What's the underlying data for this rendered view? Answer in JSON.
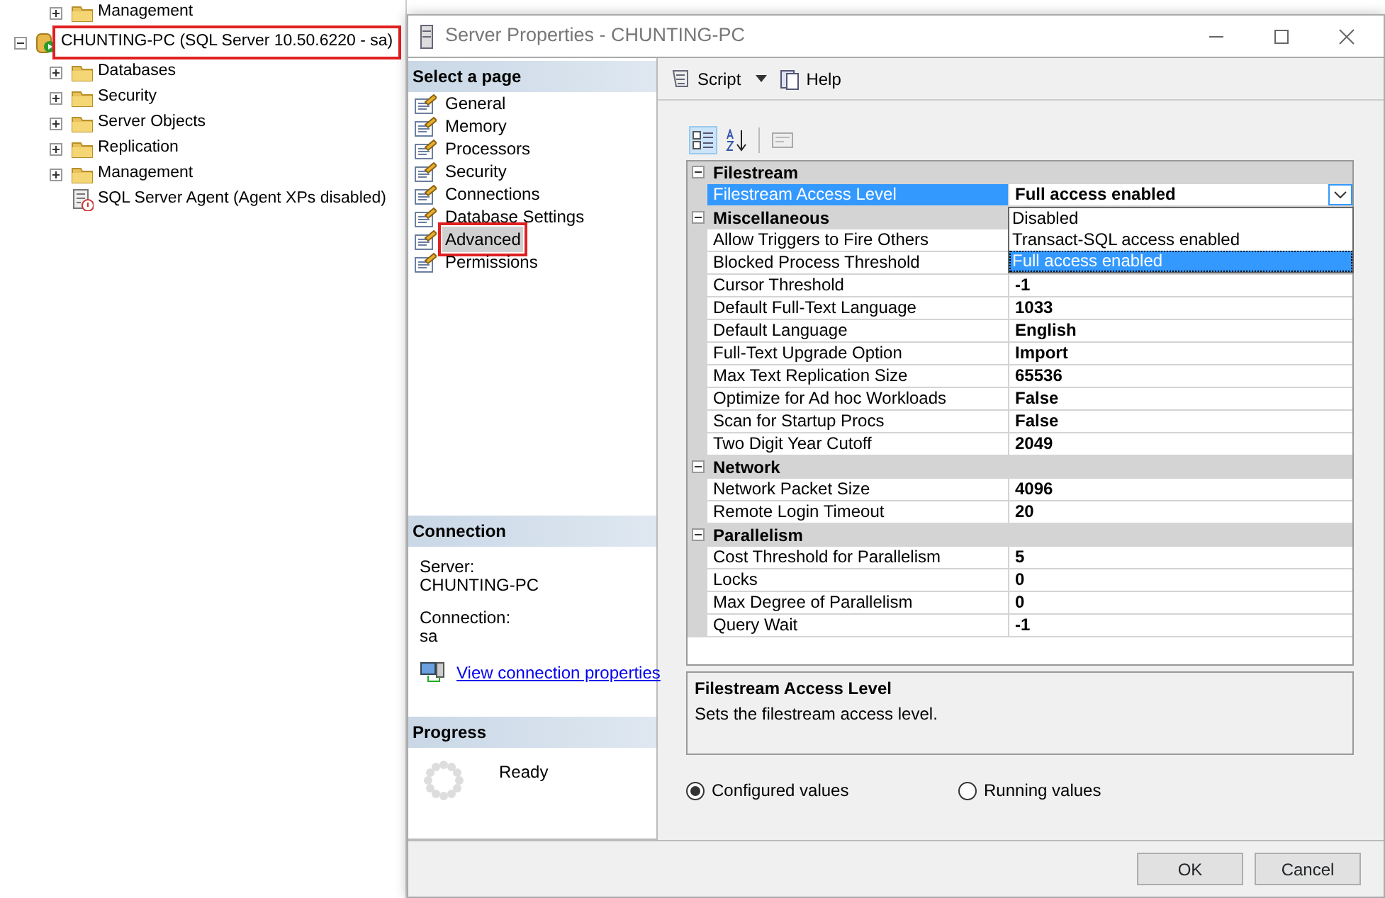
{
  "tree": {
    "above": [
      {
        "label": "Management",
        "expanded": false
      }
    ],
    "root": {
      "label": "CHUNTING-PC (SQL Server 10.50.6220 - sa)",
      "expanded": true,
      "highlighted": true,
      "children": [
        {
          "kind": "folder",
          "label": "Databases",
          "expanded": false
        },
        {
          "kind": "folder",
          "label": "Security",
          "expanded": false
        },
        {
          "kind": "folder",
          "label": "Server Objects",
          "expanded": false
        },
        {
          "kind": "folder",
          "label": "Replication",
          "expanded": false
        },
        {
          "kind": "folder",
          "label": "Management",
          "expanded": false
        },
        {
          "kind": "agent",
          "label": "SQL Server Agent (Agent XPs disabled)"
        }
      ]
    }
  },
  "dialog": {
    "title": "Server Properties - CHUNTING-PC",
    "select_header": "Select a page",
    "pages": [
      {
        "label": "General",
        "selected": false,
        "highlighted": false
      },
      {
        "label": "Memory",
        "selected": false,
        "highlighted": false
      },
      {
        "label": "Processors",
        "selected": false,
        "highlighted": false
      },
      {
        "label": "Security",
        "selected": false,
        "highlighted": false
      },
      {
        "label": "Connections",
        "selected": false,
        "highlighted": false
      },
      {
        "label": "Database Settings",
        "selected": false,
        "highlighted": false
      },
      {
        "label": "Advanced",
        "selected": true,
        "highlighted": true
      },
      {
        "label": "Permissions",
        "selected": false,
        "highlighted": false
      }
    ],
    "connection": {
      "header": "Connection",
      "server_label": "Server:",
      "server": "CHUNTING-PC",
      "connection_label": "Connection:",
      "connection": "sa",
      "link": "View connection properties"
    },
    "progress": {
      "header": "Progress",
      "status": "Ready"
    },
    "toolbar": {
      "script": "Script",
      "help": "Help"
    },
    "grid": {
      "categories": [
        {
          "name": "Filestream",
          "expanded": true,
          "properties": [
            {
              "name": "Filestream Access Level",
              "value": "Full access enabled",
              "selected": true,
              "dropdown": {
                "open": true,
                "options": [
                  {
                    "label": "Disabled",
                    "selected": false
                  },
                  {
                    "label": "Transact-SQL access enabled",
                    "selected": false
                  },
                  {
                    "label": "Full access enabled",
                    "selected": true
                  }
                ]
              }
            }
          ]
        },
        {
          "name": "Miscellaneous",
          "expanded": true,
          "properties": [
            {
              "name": "Allow Triggers to Fire Others",
              "selected": false
            },
            {
              "name": "Blocked Process Threshold",
              "selected": false
            },
            {
              "name": "Cursor Threshold",
              "value": "-1",
              "selected": false
            },
            {
              "name": "Default Full-Text Language",
              "value": "1033",
              "selected": false
            },
            {
              "name": "Default Language",
              "value": "English",
              "selected": false
            },
            {
              "name": "Full-Text Upgrade Option",
              "value": "Import",
              "selected": false
            },
            {
              "name": "Max Text Replication Size",
              "value": "65536",
              "selected": false
            },
            {
              "name": "Optimize for Ad hoc Workloads",
              "value": "False",
              "selected": false
            },
            {
              "name": "Scan for Startup Procs",
              "value": "False",
              "selected": false
            },
            {
              "name": "Two Digit Year Cutoff",
              "value": "2049",
              "selected": false
            }
          ]
        },
        {
          "name": "Network",
          "expanded": true,
          "properties": [
            {
              "name": "Network Packet Size",
              "value": "4096",
              "selected": false
            },
            {
              "name": "Remote Login Timeout",
              "value": "20",
              "selected": false
            }
          ]
        },
        {
          "name": "Parallelism",
          "expanded": true,
          "properties": [
            {
              "name": "Cost Threshold for Parallelism",
              "value": "5",
              "selected": false
            },
            {
              "name": "Locks",
              "value": "0",
              "selected": false
            },
            {
              "name": "Max Degree of Parallelism",
              "value": "0",
              "selected": false
            },
            {
              "name": "Query Wait",
              "value": "-1",
              "selected": false
            }
          ]
        }
      ]
    },
    "description": {
      "title": "Filestream Access Level",
      "text": "Sets the filestream access level."
    },
    "radios": [
      {
        "label": "Configured values",
        "selected": true
      },
      {
        "label": "Running values",
        "selected": false
      }
    ],
    "buttons": [
      "OK",
      "Cancel"
    ]
  }
}
